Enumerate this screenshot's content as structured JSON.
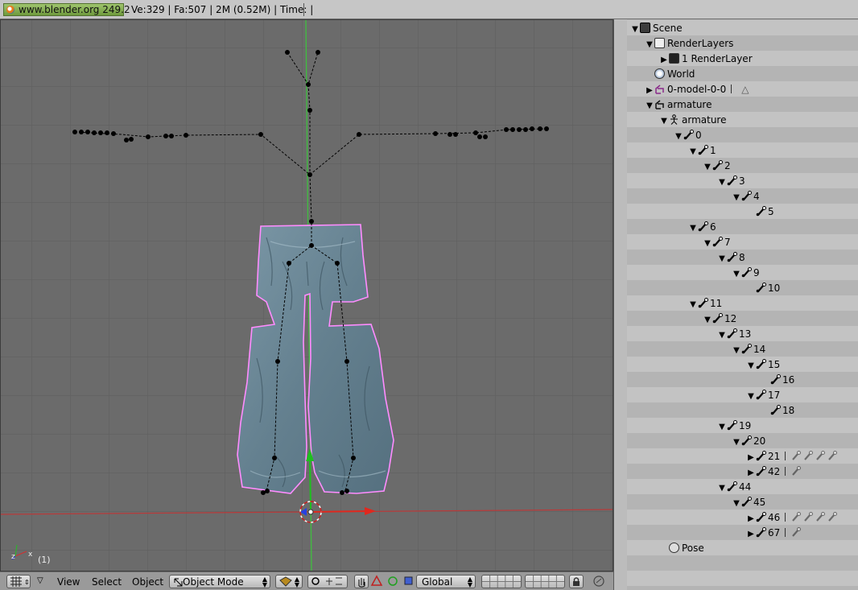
{
  "topbar": {
    "logo_text": "www.blender.org 249.2",
    "stats": "Ve:329 | Fa:507 | 2M (0.52M)   | Time: |"
  },
  "viewport": {
    "frame_label": "(1)",
    "colors": {
      "background": "#6b6b6b",
      "grid": "#5d5d5d",
      "mesh": "#6f8a98",
      "outline": "#ff88ff",
      "x_axis": "#b83a3a",
      "y_axis": "#3fbf3f"
    }
  },
  "bottombar": {
    "view_menu": "View",
    "select_menu": "Select",
    "object_menu": "Object",
    "mode": "Object Mode",
    "orientation": "Global"
  },
  "outliner": {
    "rows": [
      {
        "label": "Scene",
        "icon": "scene-icon",
        "indent": 0,
        "tri": "▼"
      },
      {
        "label": "RenderLayers",
        "icon": "renderlayers-icon",
        "indent": 1,
        "tri": "▼"
      },
      {
        "label": "1 RenderLayer",
        "icon": "renderlayer-icon",
        "indent": 2,
        "tri": "▶"
      },
      {
        "label": "World",
        "icon": "world-icon",
        "indent": 1,
        "tri": ""
      },
      {
        "label": "0-model-0-0",
        "icon": "mesh-object-icon",
        "indent": 1,
        "tri": "▶",
        "extra": "△"
      },
      {
        "label": "armature",
        "icon": "armature-object-icon",
        "indent": 1,
        "tri": "▼"
      },
      {
        "label": "armature",
        "icon": "armature-data-icon",
        "indent": 2,
        "tri": "▼"
      },
      {
        "label": "0",
        "icon": "bone-icon",
        "indent": 3,
        "tri": "▼"
      },
      {
        "label": "1",
        "icon": "bone-icon",
        "indent": 4,
        "tri": "▼"
      },
      {
        "label": "2",
        "icon": "bone-icon",
        "indent": 5,
        "tri": "▼"
      },
      {
        "label": "3",
        "icon": "bone-icon",
        "indent": 6,
        "tri": "▼"
      },
      {
        "label": "4",
        "icon": "bone-icon",
        "indent": 7,
        "tri": "▼"
      },
      {
        "label": "5",
        "icon": "bone-icon",
        "indent": 8,
        "tri": ""
      },
      {
        "label": "6",
        "icon": "bone-icon",
        "indent": 4,
        "tri": "▼"
      },
      {
        "label": "7",
        "icon": "bone-icon",
        "indent": 5,
        "tri": "▼"
      },
      {
        "label": "8",
        "icon": "bone-icon",
        "indent": 6,
        "tri": "▼"
      },
      {
        "label": "9",
        "icon": "bone-icon",
        "indent": 7,
        "tri": "▼"
      },
      {
        "label": "10",
        "icon": "bone-icon",
        "indent": 8,
        "tri": ""
      },
      {
        "label": "11",
        "icon": "bone-icon",
        "indent": 4,
        "tri": "▼"
      },
      {
        "label": "12",
        "icon": "bone-icon",
        "indent": 5,
        "tri": "▼"
      },
      {
        "label": "13",
        "icon": "bone-icon",
        "indent": 6,
        "tri": "▼"
      },
      {
        "label": "14",
        "icon": "bone-icon",
        "indent": 7,
        "tri": "▼"
      },
      {
        "label": "15",
        "icon": "bone-icon",
        "indent": 8,
        "tri": "▼"
      },
      {
        "label": "16",
        "icon": "bone-icon",
        "indent": 9,
        "tri": ""
      },
      {
        "label": "17",
        "icon": "bone-icon",
        "indent": 8,
        "tri": "▼"
      },
      {
        "label": "18",
        "icon": "bone-icon",
        "indent": 9,
        "tri": ""
      },
      {
        "label": "19",
        "icon": "bone-icon",
        "indent": 6,
        "tri": "▼"
      },
      {
        "label": "20",
        "icon": "bone-icon",
        "indent": 7,
        "tri": "▼"
      },
      {
        "label": "21",
        "icon": "bone-icon",
        "indent": 8,
        "tri": "▶",
        "extra_bones": 4
      },
      {
        "label": "42",
        "icon": "bone-icon",
        "indent": 8,
        "tri": "▶",
        "extra_bones": 1
      },
      {
        "label": "44",
        "icon": "bone-icon",
        "indent": 6,
        "tri": "▼"
      },
      {
        "label": "45",
        "icon": "bone-icon",
        "indent": 7,
        "tri": "▼"
      },
      {
        "label": "46",
        "icon": "bone-icon",
        "indent": 8,
        "tri": "▶",
        "extra_bones": 4
      },
      {
        "label": "67",
        "icon": "bone-icon",
        "indent": 8,
        "tri": "▶",
        "extra_bones": 1
      },
      {
        "label": "Pose",
        "icon": "pose-icon",
        "indent": 2,
        "tri": ""
      }
    ]
  }
}
